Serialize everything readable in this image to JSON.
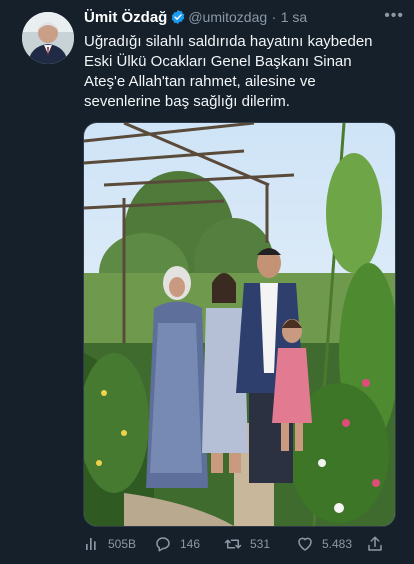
{
  "tweet": {
    "author_name": "Ümit Özdağ",
    "handle": "@umitozdag",
    "separator": "·",
    "time": "1 sa",
    "more_label": "•••",
    "text_lines": [
      "Uğradığı silahlı saldırıda hayatını kaybeden",
      "Eski Ülkü Ocakları Genel Başkanı Sinan",
      "Ateş'e Allah'tan rahmet, ailesine ve",
      "sevenlerine baş sağlığı dilerim."
    ]
  },
  "actions": {
    "views": "505B",
    "replies": "146",
    "retweets": "531",
    "likes": "5.483"
  },
  "icons": {
    "verified": "verified-badge-icon",
    "views": "analytics-icon",
    "reply": "reply-icon",
    "retweet": "retweet-icon",
    "like": "heart-icon",
    "share": "share-icon"
  },
  "colors": {
    "background": "#15202b",
    "verified": "#1d9bf0",
    "muted": "#8b98a5"
  }
}
